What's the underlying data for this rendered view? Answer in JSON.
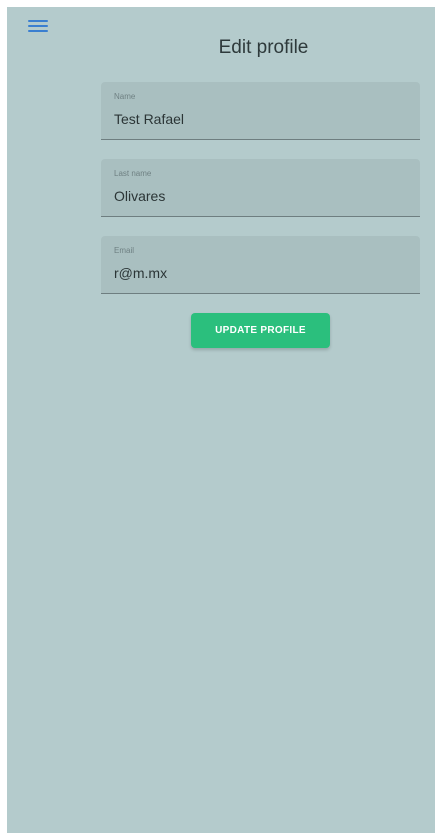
{
  "header": {
    "menu_icon": "hamburger-menu-icon",
    "title": "Edit profile"
  },
  "form": {
    "name": {
      "label": "Name",
      "value": "Test Rafael"
    },
    "last_name": {
      "label": "Last name",
      "value": "Olivares"
    },
    "email": {
      "label": "Email",
      "value": "r@m.mx"
    }
  },
  "actions": {
    "update_label": "UPDATE PROFILE"
  },
  "colors": {
    "background": "#b4cbcc",
    "field_background": "#a9bfc0",
    "accent_button": "#2bbf7d",
    "menu_icon": "#3a7fd0"
  }
}
